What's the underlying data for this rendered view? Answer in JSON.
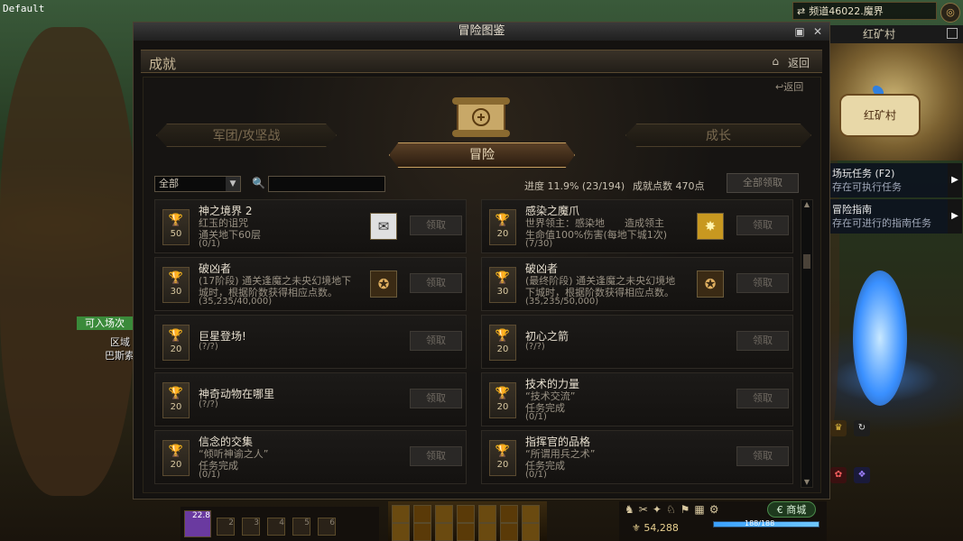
{
  "debug_label": "Default",
  "channel": {
    "text": "频道46022.魔界"
  },
  "minimap": {
    "title": "红矿村",
    "town_label": "红矿村"
  },
  "quests": [
    {
      "title": "场玩任务 (F2)",
      "subtitle": "存在可执行任务"
    },
    {
      "title": "冒险指南",
      "subtitle": "存在可进行的指南任务"
    }
  ],
  "side": {
    "enter_badge": "可入场次",
    "zone": "区域",
    "name": "巴斯索"
  },
  "window": {
    "title": "冒险图鉴",
    "subtitle": "成就",
    "back_label": "返回",
    "small_back_label": "返回",
    "categories": {
      "left": "军团/攻坚战",
      "middle": "冒险",
      "right": "成长"
    },
    "filter": {
      "selected": "全部"
    },
    "search": {
      "placeholder": ""
    },
    "progress": "进度 11.9% (23/194)",
    "points": "成就点数 470点",
    "claim_all_label": "全部领取",
    "claim_label": "领取",
    "cards": [
      {
        "points": "50",
        "title": "神之境界 2",
        "lines": [
          "红玉的诅咒",
          "通关地下60层"
        ],
        "progress": "(0/1)",
        "reward": "scroll-icon"
      },
      {
        "points": "20",
        "title": "感染之魔爪",
        "lines": [
          "世界领主：感染地　　造成领主",
          "生命值100%伤害(每地下城1次)"
        ],
        "progress": "(7/30)",
        "reward": "gold-box-icon"
      },
      {
        "points": "30",
        "title": "破凶者",
        "lines": [
          "(17阶段) 通关逢魔之未央幻境地下",
          "城时，根据阶数获得相应点数。"
        ],
        "progress": "(35,235/40,000)",
        "reward": "emblem-icon"
      },
      {
        "points": "30",
        "title": "破凶者",
        "lines": [
          "(最终阶段) 通关逢魔之未央幻境地",
          "下城时，根据阶数获得相应点数。"
        ],
        "progress": "(35,235/50,000)",
        "reward": "emblem-icon"
      },
      {
        "points": "20",
        "title": "巨星登场!",
        "lines": [],
        "progress": "(?/?)",
        "reward": ""
      },
      {
        "points": "20",
        "title": "初心之箭",
        "lines": [],
        "progress": "(?/?)",
        "reward": ""
      },
      {
        "points": "20",
        "title": "神奇动物在哪里",
        "lines": [],
        "progress": "(?/?)",
        "reward": ""
      },
      {
        "points": "20",
        "title": "技术的力量",
        "lines": [
          "“技术交流”",
          "任务完成"
        ],
        "progress": "(0/1)",
        "reward": ""
      },
      {
        "points": "20",
        "title": "信念的交集",
        "lines": [
          "“倾听神谕之人”",
          "任务完成"
        ],
        "progress": "(0/1)",
        "reward": ""
      },
      {
        "points": "20",
        "title": "指挥官的品格",
        "lines": [
          "“所谓用兵之术”",
          "任务完成"
        ],
        "progress": "(0/1)",
        "reward": ""
      }
    ]
  },
  "hud": {
    "level_text": "22.8",
    "gold": "54,288",
    "shop_label": "商城",
    "hp_text": "188/188",
    "hp_fraction": 1.0,
    "skill_slots": [
      "2",
      "3",
      "4",
      "5",
      "6"
    ]
  }
}
